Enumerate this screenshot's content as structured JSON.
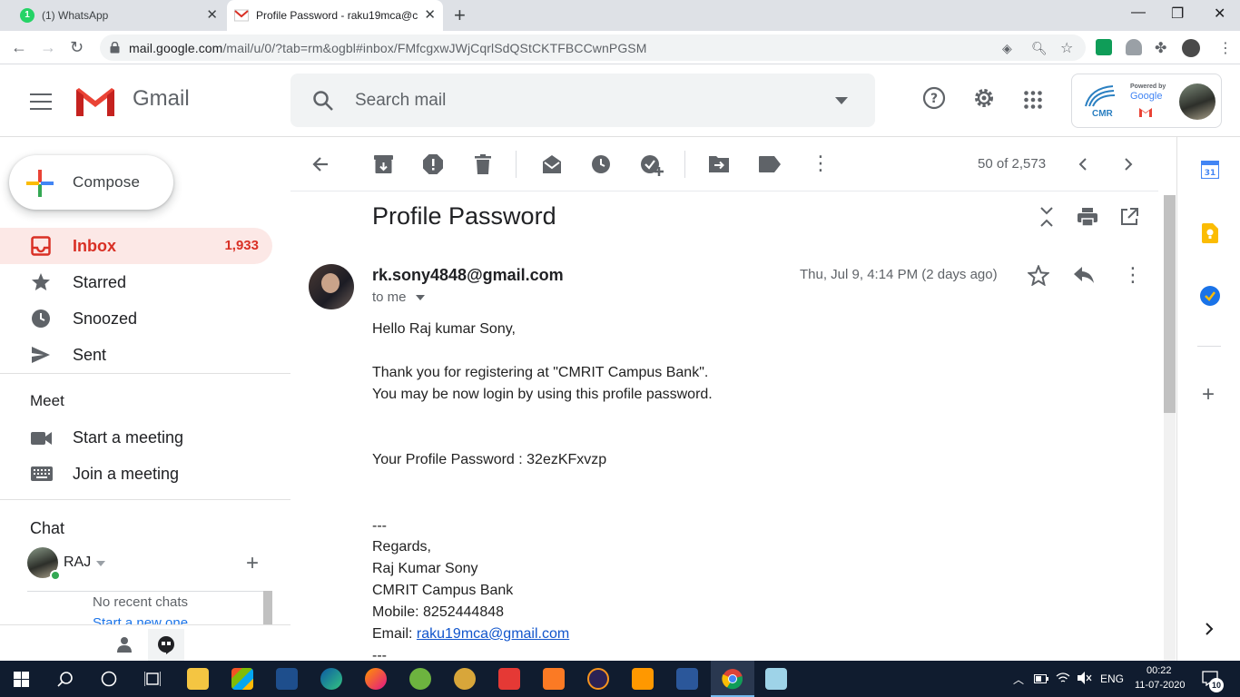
{
  "browser": {
    "tabs": [
      {
        "title": "(1) WhatsApp",
        "badge": "1"
      },
      {
        "title": "Profile Password - raku19mca@c"
      }
    ],
    "url_host": "mail.google.com",
    "url_path": "/mail/u/0/?tab=rm&ogbl#inbox/FMfcgxwJWjCqrlSdQStCKTFBCCwnPGSM"
  },
  "gmail": {
    "app_name": "Gmail",
    "search_placeholder": "Search mail",
    "compose_label": "Compose",
    "nav": [
      {
        "label": "Inbox",
        "count": "1,933",
        "icon": "inbox-icon"
      },
      {
        "label": "Starred",
        "icon": "star-icon"
      },
      {
        "label": "Snoozed",
        "icon": "clock-icon"
      },
      {
        "label": "Sent",
        "icon": "send-icon"
      }
    ],
    "meet": {
      "heading": "Meet",
      "items": [
        {
          "label": "Start a meeting",
          "icon": "video-icon"
        },
        {
          "label": "Join a meeting",
          "icon": "keyboard-icon"
        }
      ]
    },
    "chat": {
      "heading": "Chat",
      "user": "RAJ",
      "empty_text": "No recent chats",
      "start_link": "Start a new one"
    },
    "pager": "50 of 2,573",
    "brand_colors": {
      "red": "#d93025",
      "blue": "#1a73e8",
      "yellow": "#fbbc04",
      "green": "#34a853"
    }
  },
  "message": {
    "subject": "Profile Password",
    "sender": "rk.sony4848@gmail.com",
    "to_label": "to me",
    "date": "Thu, Jul 9, 4:14 PM (2 days ago)",
    "greeting": "Hello Raj kumar Sony,",
    "line1": "Thank you for registering at \"CMRIT Campus Bank\".",
    "line2": "You may be now login by using this profile password.",
    "password_line": "Your Profile Password : 32ezKFxvzp",
    "sep": "---",
    "regards": "Regards,",
    "sig_name": "Raj Kumar Sony",
    "sig_org": "CMRIT Campus Bank",
    "sig_mobile": "Mobile: 8252444848",
    "sig_email_label": "Email: ",
    "sig_email": "raku19mca@gmail.com",
    "sep2": "---"
  },
  "account": {
    "powered_by": "Powered by",
    "google": "Google",
    "org": "CMR"
  },
  "taskbar": {
    "lang": "ENG",
    "time": "00:22",
    "date": "11-07-2020",
    "notifications": "10"
  }
}
